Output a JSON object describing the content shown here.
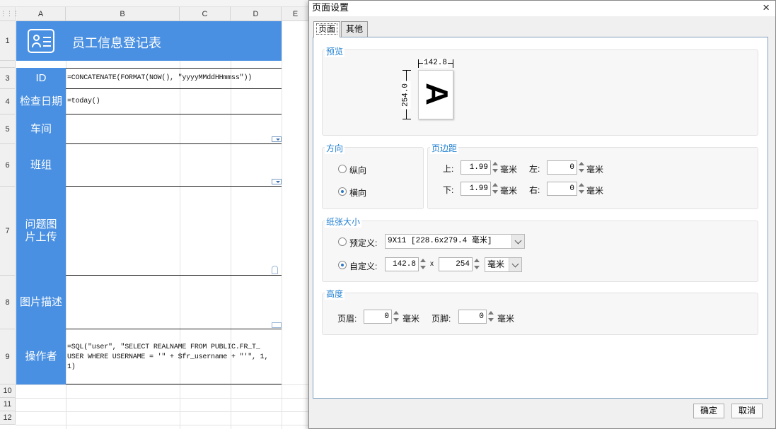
{
  "sheet": {
    "corner_icon": "grid-icon",
    "columns": [
      "A",
      "B",
      "C",
      "D",
      "E"
    ],
    "rows": [
      "1",
      "3",
      "4",
      "5",
      "6",
      "7",
      "8",
      "9",
      "10",
      "11",
      "12"
    ],
    "title": "员工信息登记表",
    "title_icon": "id-card-icon",
    "labels": {
      "id": "ID",
      "check_date": "检查日期",
      "workshop": "车间",
      "team": "班组",
      "photo": "问题图片上传",
      "photo_desc": "图片描述",
      "operator": "操作者"
    },
    "formulas": {
      "id": "=CONCATENATE(FORMAT(NOW(), \"yyyyMMddHHmmss\"))",
      "check_date": "=today()",
      "operator_1": "=SQL(\"user\", \"SELECT REALNAME FROM PUBLIC.FR_T_",
      "operator_2": "USER WHERE USERNAME = '\" + $fr_username + \"'\", 1,",
      "operator_3": "1)"
    },
    "colors": {
      "header_blue": "#4a90e2"
    }
  },
  "dialog": {
    "title": "页面设置",
    "close": "×",
    "tabs": [
      "页面",
      "其他"
    ],
    "active_tab": "页面",
    "preview": {
      "title": "预览",
      "width_label": "142.8",
      "height_label": "254.0",
      "glyph": "A"
    },
    "orientation": {
      "title": "方向",
      "portrait": "纵向",
      "landscape": "横向",
      "selected": "横向"
    },
    "margins": {
      "title": "页边距",
      "top_label": "上:",
      "top": "1.99",
      "left_label": "左:",
      "left": "0",
      "bottom_label": "下:",
      "bottom": "1.99",
      "right_label": "右:",
      "right": "0",
      "unit": "毫米"
    },
    "paper": {
      "title": "纸张大小",
      "preset_label": "预定义:",
      "preset_value": "9X11 [228.6x279.4 毫米]",
      "custom_label": "自定义:",
      "width": "142.8",
      "x": "x",
      "height": "254",
      "unit": "毫米",
      "selected": "自定义"
    },
    "height": {
      "title": "高度",
      "header_label": "页眉:",
      "header": "0",
      "footer_label": "页脚:",
      "footer": "0",
      "unit": "毫米"
    },
    "buttons": {
      "ok": "确定",
      "cancel": "取消"
    }
  }
}
